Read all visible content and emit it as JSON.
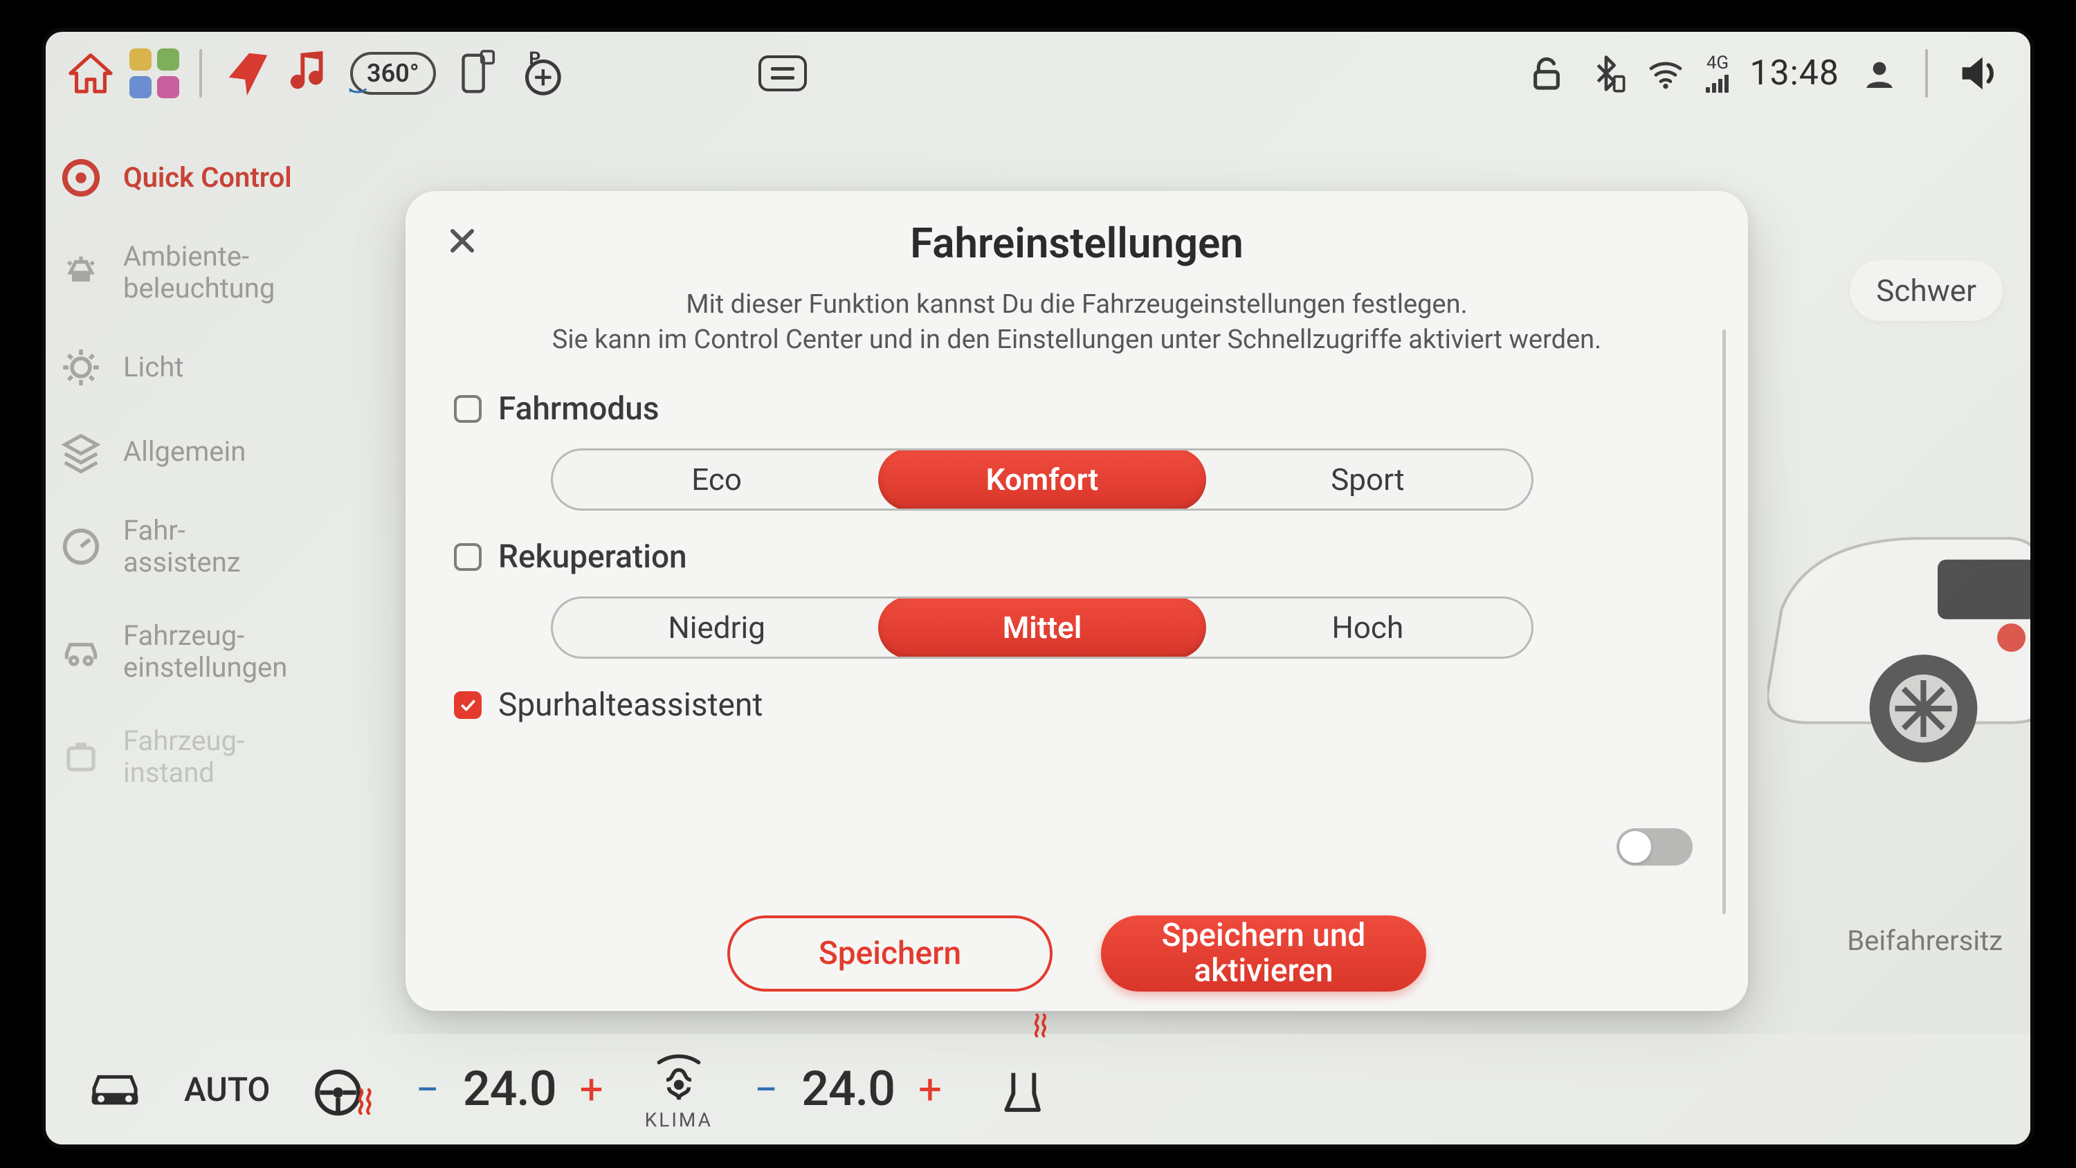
{
  "status": {
    "camera_label": "360°",
    "network_type": "4G",
    "time": "13:48"
  },
  "sidebar": {
    "items": [
      {
        "label": "Quick Control"
      },
      {
        "label": "Ambiente-\nbeleuchtung"
      },
      {
        "label": "Licht"
      },
      {
        "label": "Allgemein"
      },
      {
        "label": "Fahr-\nassistenz"
      },
      {
        "label": "Fahrzeug-\neinstellungen"
      },
      {
        "label": "Fahrzeug-\ninstand"
      }
    ]
  },
  "background": {
    "right_pill": "Schwer",
    "right_bottom": "Beifahrersitz"
  },
  "modal": {
    "title": "Fahreinstellungen",
    "description_l1": "Mit dieser Funktion kannst Du die Fahrzeugeinstellungen festlegen.",
    "description_l2": "Sie kann im Control Center und in den Einstellungen unter Schnellzugriffe aktiviert werden.",
    "sections": {
      "drive_mode": {
        "label": "Fahrmodus",
        "checked": false,
        "options": [
          "Eco",
          "Komfort",
          "Sport"
        ],
        "selected": 1
      },
      "recuperation": {
        "label": "Rekuperation",
        "checked": false,
        "options": [
          "Niedrig",
          "Mittel",
          "Hoch"
        ],
        "selected": 1
      },
      "lane_assist": {
        "label": "Spurhalteassistent",
        "checked": true,
        "toggle_on": false
      }
    },
    "actions": {
      "save": "Speichern",
      "save_activate": "Speichern und\naktivieren"
    }
  },
  "climate": {
    "auto": "AUTO",
    "left_temp": "24.0",
    "right_temp": "24.0",
    "klima_label": "KLIMA"
  }
}
